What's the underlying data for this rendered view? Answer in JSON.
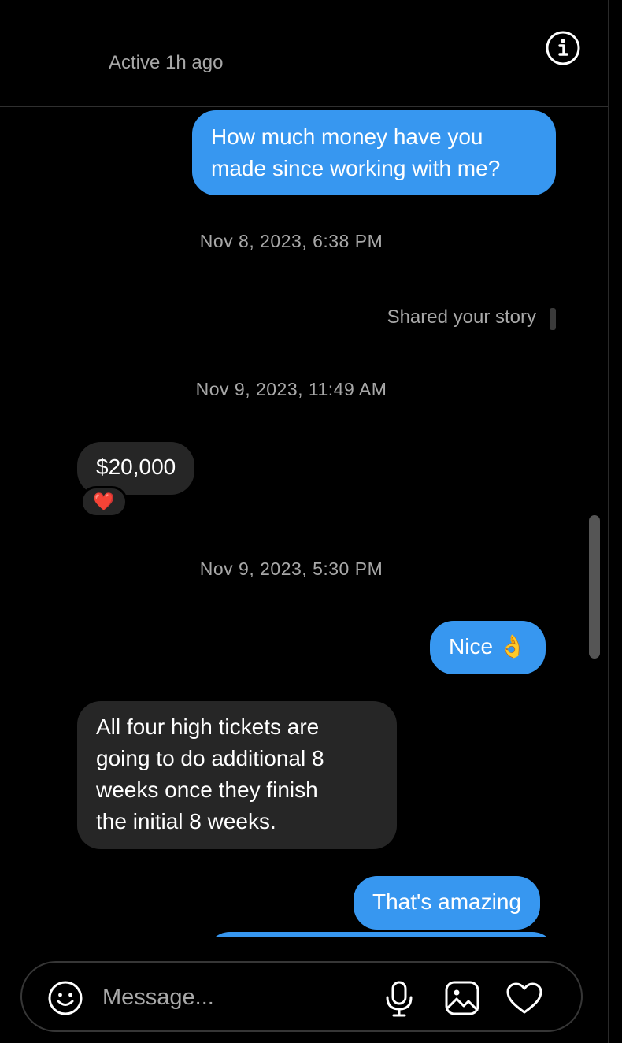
{
  "header": {
    "active_status": "Active 1h ago",
    "info_icon": "info-icon"
  },
  "messages": [
    {
      "direction": "outgoing",
      "text": "How much money have you made since working with me?",
      "lines": [
        "How much money have you",
        "made since working with me?"
      ]
    },
    {
      "type": "timestamp",
      "text": "Nov 8, 2023, 6:38 PM"
    },
    {
      "type": "story-share",
      "text": "Shared your story"
    },
    {
      "type": "timestamp",
      "text": "Nov 9, 2023, 11:49 AM"
    },
    {
      "direction": "incoming",
      "text": "$20,000",
      "reaction": "❤️"
    },
    {
      "type": "timestamp",
      "text": "Nov 9, 2023, 5:30 PM"
    },
    {
      "direction": "outgoing",
      "text": "Nice 👌"
    },
    {
      "direction": "incoming",
      "text": "All four high tickets are going to do additional 8 weeks once they finish the initial 8 weeks.",
      "lines": [
        "All four high tickets are",
        "going to do additional 8",
        "weeks once they finish",
        "the initial 8 weeks."
      ]
    },
    {
      "direction": "outgoing",
      "text": "That's amazing"
    }
  ],
  "composer": {
    "placeholder": "Message...",
    "icons": [
      "emoji-icon",
      "microphone-icon",
      "image-icon",
      "heart-icon"
    ]
  },
  "colors": {
    "background": "#000000",
    "outgoing_bubble": "#3797f0",
    "incoming_bubble": "#262626",
    "muted_text": "#a8a8a8"
  }
}
